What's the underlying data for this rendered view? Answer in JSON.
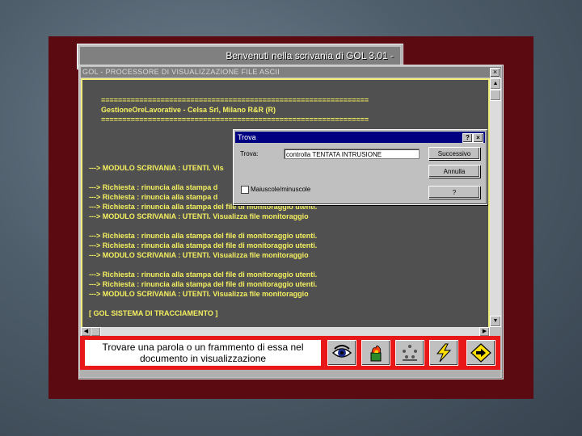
{
  "background_window": {
    "title": "Benvenuti nella scrivania di GOL 3.01 -"
  },
  "viewer": {
    "title": "GOL - PROCESSORE DI VISUALIZZAZIONE FILE ASCII",
    "close_glyph": "×",
    "lines": [
      "===============================================================",
      "GestioneOreLavorative - Celsa Srl, Milano              R&R (R)",
      "===============================================================",
      "---> MODULO SCRIVANIA : UTENTI. Vis",
      "---> Richiesta : rinuncia alla stampa d",
      "---> Richiesta : rinuncia alla stampa d",
      "---> Richiesta : rinuncia alla stampa del file di monitoraggio utenti.",
      "---> MODULO SCRIVANIA : UTENTI. Visualizza file monitoraggio",
      "---> Richiesta : rinuncia alla stampa del file di monitoraggio utenti.",
      "---> Richiesta : rinuncia alla stampa del file di monitoraggio utenti.",
      "---> MODULO SCRIVANIA : UTENTI. Visualizza file monitoraggio",
      "---> Richiesta : rinuncia alla stampa del file di monitoraggio utenti.",
      "---> Richiesta : rinuncia alla stampa del file di monitoraggio utenti.",
      "---> MODULO SCRIVANIA : UTENTI. Visualizza file monitoraggio",
      "[ GOL SISTEMA DI TRACCIAMENTO ]"
    ]
  },
  "toolbar": {
    "hint": "Trovare una parola o un frammento di essa nel documento in visualizzazione",
    "buttons": [
      {
        "icon": "eye-icon"
      },
      {
        "icon": "flame-icon"
      },
      {
        "icon": "people-icon"
      },
      {
        "icon": "lightning-icon"
      },
      {
        "icon": "arrow-right-icon"
      }
    ]
  },
  "find_dialog": {
    "title": "Trova",
    "help_glyph": "?",
    "close_glyph": "×",
    "find_label": "Trova:",
    "find_value": "controlla TENTATA INTRUSIONE",
    "next_button": "Successivo",
    "cancel_button": "Annulla",
    "help_button": "?",
    "case_label": "Maiuscole/minuscole",
    "case_checked": false
  },
  "colors": {
    "text": "#f5f060",
    "slide_bg": "#5a0a10",
    "toolbar": "#e81818",
    "dialog_title": "#000080"
  }
}
